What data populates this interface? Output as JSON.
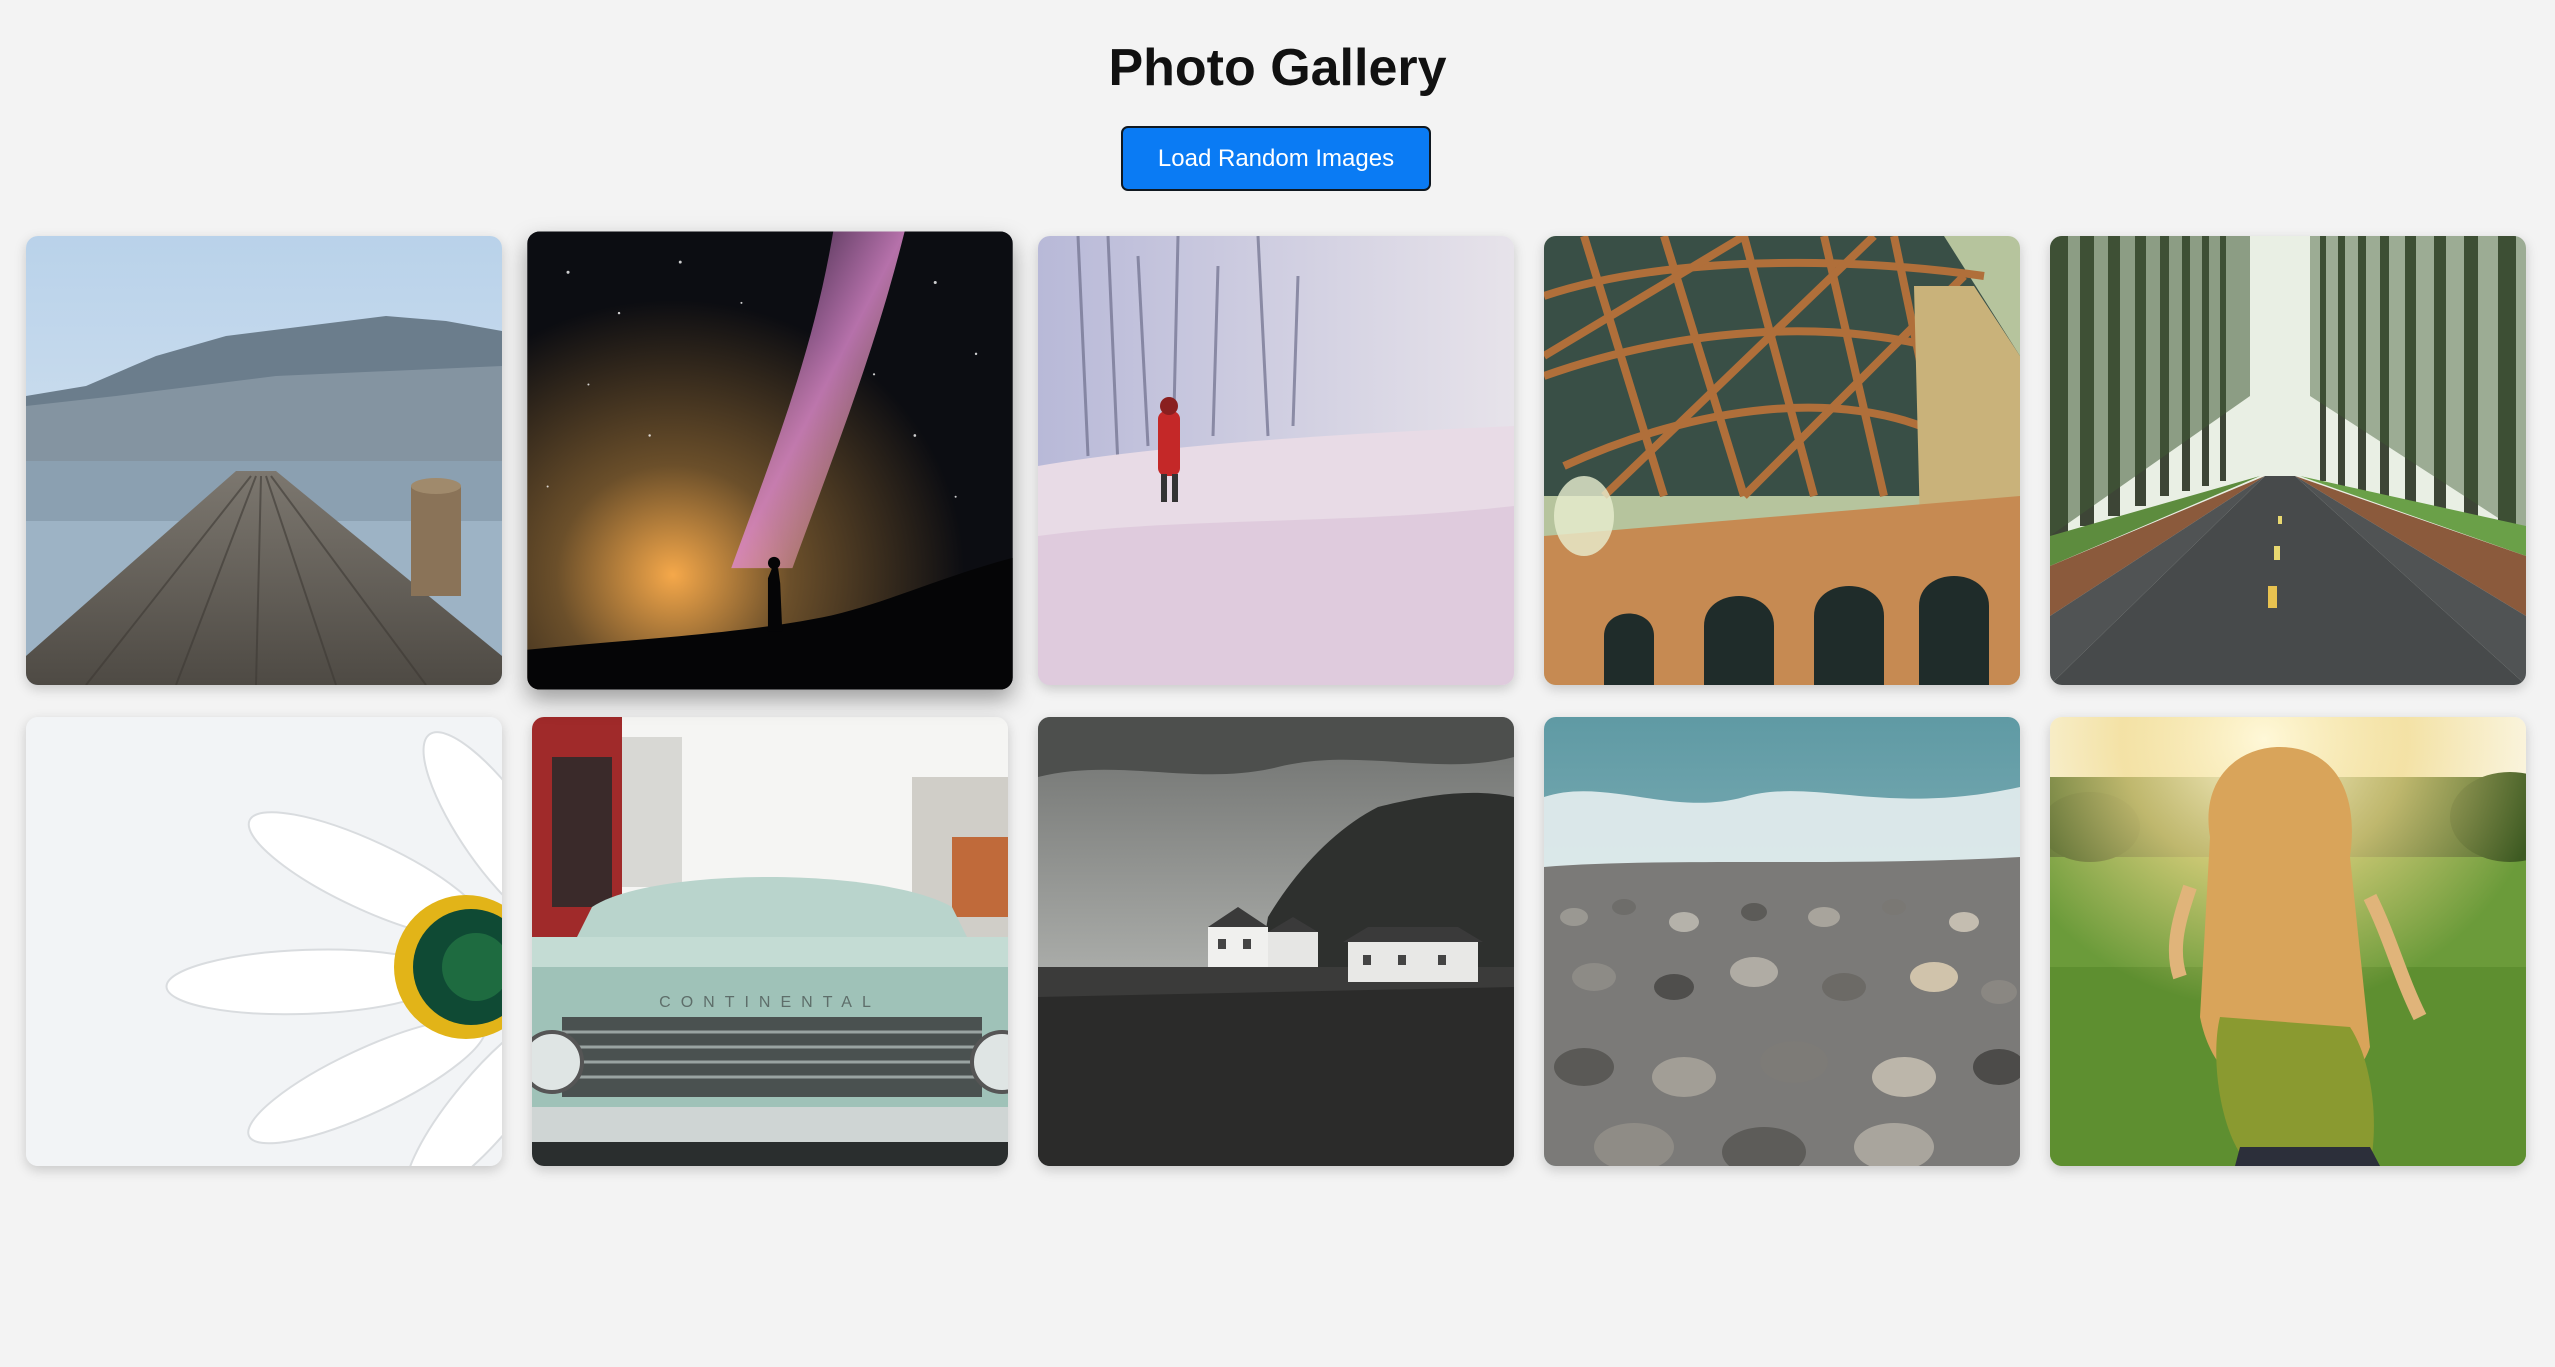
{
  "header": {
    "title": "Photo Gallery",
    "load_button_label": "Load Random Images"
  },
  "gallery": {
    "images": [
      {
        "subject": "wooden pier over mountain lake"
      },
      {
        "subject": "person silhouette under milky way"
      },
      {
        "subject": "person in red coat in snowy field"
      },
      {
        "subject": "steel bridge girders and arches"
      },
      {
        "subject": "road through tall pine forest"
      },
      {
        "subject": "white daisy close-up"
      },
      {
        "subject": "front of vintage car",
        "emblem_text": "CONTINENTAL"
      },
      {
        "subject": "white cottages below cliff"
      },
      {
        "subject": "pebble beach with waves"
      },
      {
        "subject": "woman in sunlit meadow"
      }
    ]
  },
  "colors": {
    "background": "#f3f3f3",
    "button": "#0a7bf4",
    "button_border": "#101820"
  }
}
